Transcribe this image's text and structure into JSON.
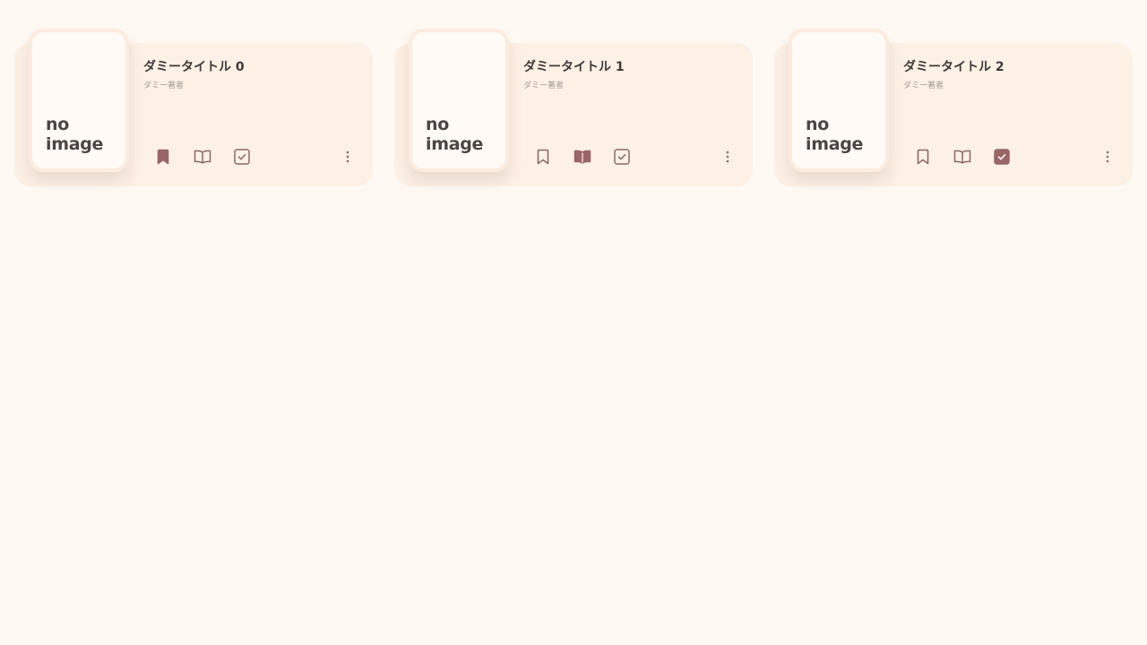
{
  "colors": {
    "background": "#fff9f4",
    "card": "#fdf0e5",
    "accent": "#9a6566",
    "muted_icon": "#8a6a66"
  },
  "books": [
    {
      "cover_text": "no\nimage",
      "title": "ダミータイトル 0",
      "author": "ダミー著者",
      "status": {
        "want_to_read": true,
        "reading": false,
        "finished": false
      }
    },
    {
      "cover_text": "no\nimage",
      "title": "ダミータイトル 1",
      "author": "ダミー著者",
      "status": {
        "want_to_read": false,
        "reading": true,
        "finished": false
      }
    },
    {
      "cover_text": "no\nimage",
      "title": "ダミータイトル 2",
      "author": "ダミー著者",
      "status": {
        "want_to_read": false,
        "reading": false,
        "finished": true
      }
    }
  ],
  "icons": {
    "bookmark": "bookmark-icon",
    "book": "open-book-icon",
    "check": "checkbox-icon",
    "more": "more-vert-icon"
  }
}
